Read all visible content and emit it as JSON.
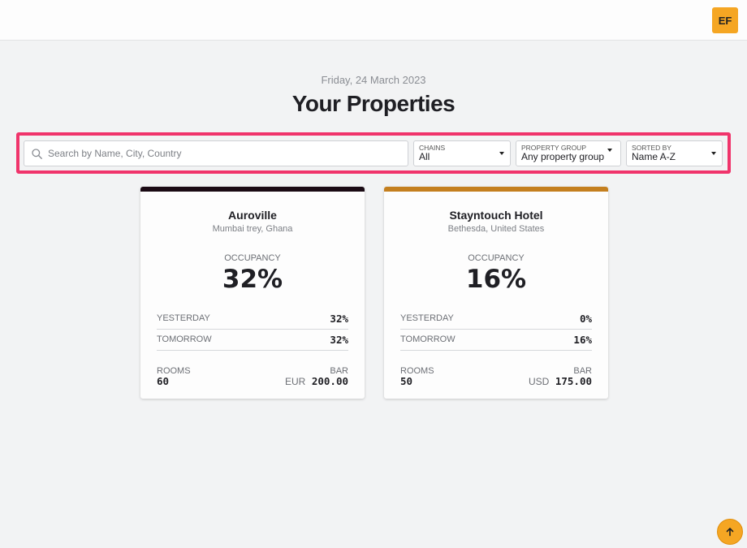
{
  "header": {
    "avatar_initials": "EF"
  },
  "page": {
    "date": "Friday, 24 March 2023",
    "title": "Your Properties"
  },
  "filters": {
    "search_placeholder": "Search by Name, City, Country",
    "search_value": "",
    "chains": {
      "label": "CHAINS",
      "value": "All"
    },
    "property_group": {
      "label": "PROPERTY GROUP",
      "value": "Any property group"
    },
    "sorted_by": {
      "label": "SORTED BY",
      "value": "Name A-Z"
    }
  },
  "properties": [
    {
      "name": "Auroville",
      "location": "Mumbai trey, Ghana",
      "accent_color": "#1a0a14",
      "occupancy_label": "OCCUPANCY",
      "occupancy": "32%",
      "yesterday_label": "YESTERDAY",
      "yesterday": "32%",
      "tomorrow_label": "TOMORROW",
      "tomorrow": "32%",
      "rooms_label": "ROOMS",
      "rooms": "60",
      "bar_label": "BAR",
      "bar_currency": "EUR",
      "bar_value": "200.00"
    },
    {
      "name": "Stayntouch Hotel",
      "location": "Bethesda, United States",
      "accent_color": "#c47f1f",
      "occupancy_label": "OCCUPANCY",
      "occupancy": "16%",
      "yesterday_label": "YESTERDAY",
      "yesterday": "0%",
      "tomorrow_label": "TOMORROW",
      "tomorrow": "16%",
      "rooms_label": "ROOMS",
      "rooms": "50",
      "bar_label": "BAR",
      "bar_currency": "USD",
      "bar_value": "175.00"
    }
  ],
  "icons": {
    "search": "search-icon",
    "scroll_top": "arrow-up-icon"
  },
  "colors": {
    "accent": "#f5a623",
    "filter_highlight": "#f0346b"
  }
}
